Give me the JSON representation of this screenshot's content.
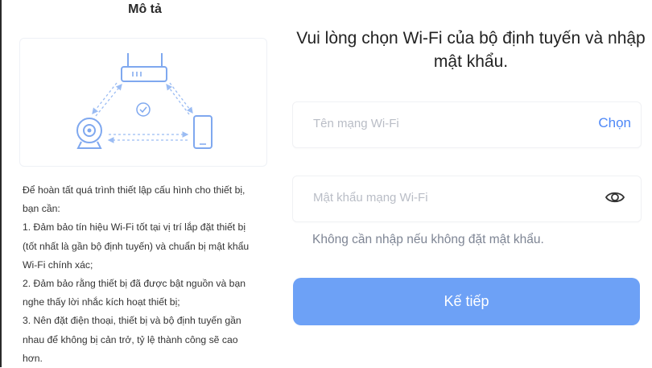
{
  "left": {
    "title": "Mô tả",
    "description_lines": [
      "Để hoàn tất quá trình thiết lập cấu hình cho thiết bị,",
      "bạn cần:",
      "1. Đảm bảo tín hiệu Wi-Fi tốt tại vị trí lắp đặt thiết bị",
      "(tốt nhất là gần bộ định tuyến) và chuẩn bị mật khẩu",
      "Wi-Fi chính xác;",
      "2. Đảm bảo rằng thiết bị đã được bật nguồn và bạn",
      "nghe thấy lời nhắc kích hoạt thiết bị;",
      "3. Nên đặt điện thoại, thiết bị và bộ định tuyến gần",
      "nhau để không bị cản trở, tỷ lệ thành công sẽ cao",
      "hơn."
    ]
  },
  "right": {
    "heading": "Vui lòng chọn Wi-Fi của bộ định tuyến và nhập mật khẩu.",
    "wifi_name_placeholder": "Tên mạng Wi-Fi",
    "select_label": "Chọn",
    "password_placeholder": "Mật khẩu mạng Wi-Fi",
    "hint": "Không cần nhập nếu không đặt mật khẩu.",
    "next_label": "Kế tiếp"
  },
  "colors": {
    "accent": "#4d87f7",
    "button": "#6da1f6",
    "illustration": "#7fa8ef"
  }
}
